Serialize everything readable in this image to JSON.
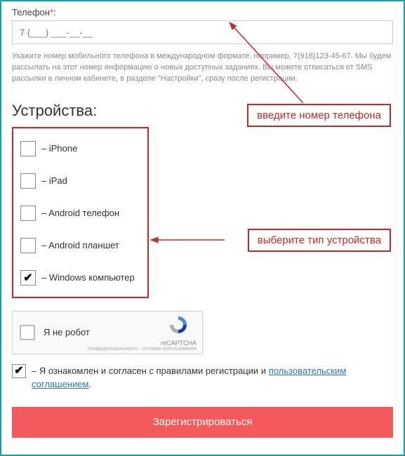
{
  "phone": {
    "label": "Телефон",
    "required_mark": "*",
    "colon": ":",
    "placeholder": "7 (___) ___-__-__",
    "hint": "Укажите номер мобильного телефона в международном формате, например, 7(916)123-45-67. Мы будем рассылать на этот номер информацию о новых доступных заданиях. Вы можете отписаться от SMS рассылки в личном кабинете, в разделе \"Настройки\", сразу после регистрации."
  },
  "devices": {
    "title": "Устройства:",
    "items": [
      {
        "label": "iPhone",
        "checked": false
      },
      {
        "label": "iPad",
        "checked": false
      },
      {
        "label": "Android телефон",
        "checked": false
      },
      {
        "label": "Android планшет",
        "checked": false
      },
      {
        "label": "Windows компьютер",
        "checked": true
      }
    ]
  },
  "callouts": {
    "phone": "введите номер телефона",
    "device": "выберите тип устройства"
  },
  "recaptcha": {
    "label": "Я не робот",
    "brand": "reCAPTCHA",
    "links": "Конфиденциальность - Условия использования"
  },
  "agreement": {
    "checked": true,
    "prefix": "– Я ознакомлен и согласен с правилами регистрации и ",
    "link": "пользовательским соглашением",
    "suffix": "."
  },
  "submit": {
    "label": "Зарегистрироваться"
  },
  "dash_prefix": "– "
}
